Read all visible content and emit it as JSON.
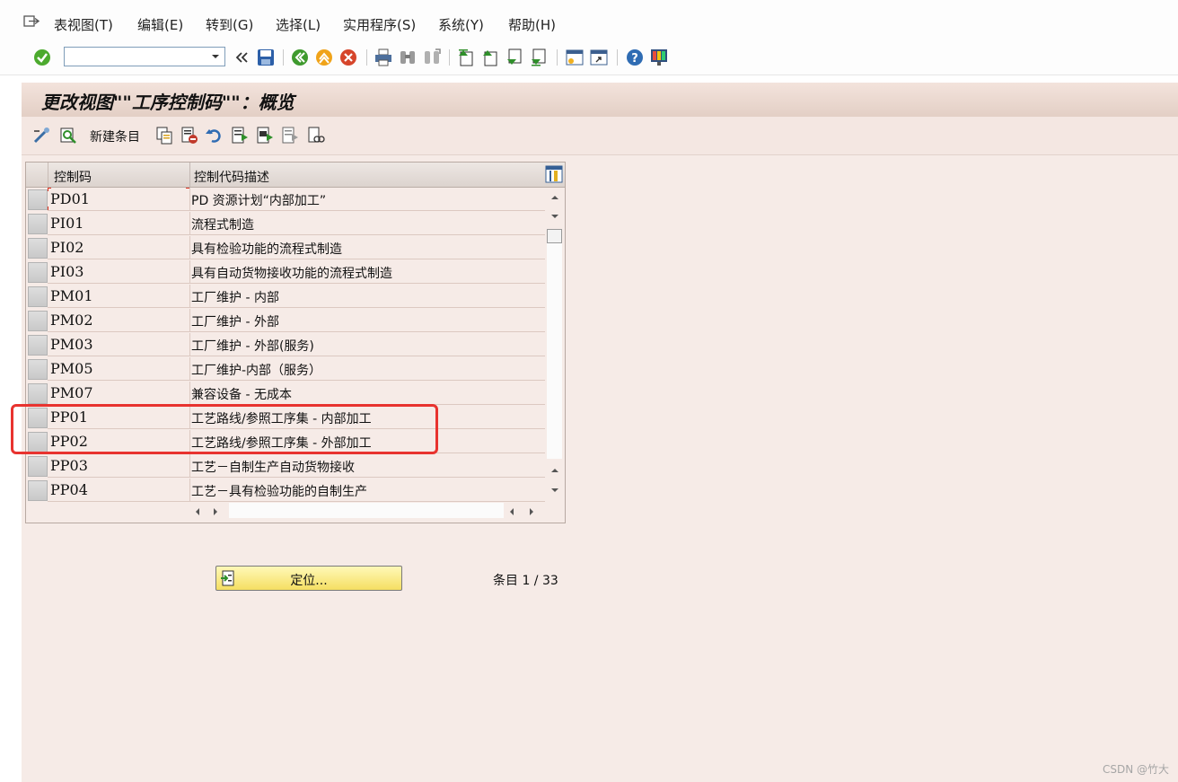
{
  "menubar": {
    "items": [
      "表视图(T)",
      "编辑(E)",
      "转到(G)",
      "选择(L)",
      "实用程序(S)",
      "系统(Y)",
      "帮助(H)"
    ]
  },
  "toolbar": {
    "command_value": ""
  },
  "screen": {
    "title": "更改视图\"\"工序控制码\"\"：概览",
    "new_entries_label": "新建条目"
  },
  "table": {
    "headers": [
      "控制码",
      "控制代码描述"
    ],
    "rows": [
      {
        "code": "PD01",
        "desc": "PD 资源计划“内部加工”"
      },
      {
        "code": "PI01",
        "desc": "流程式制造"
      },
      {
        "code": "PI02",
        "desc": "具有检验功能的流程式制造"
      },
      {
        "code": "PI03",
        "desc": "具有自动货物接收功能的流程式制造"
      },
      {
        "code": "PM01",
        "desc": "工厂维护 - 内部"
      },
      {
        "code": "PM02",
        "desc": "工厂维护 - 外部"
      },
      {
        "code": "PM03",
        "desc": "工厂维护 - 外部(服务)"
      },
      {
        "code": "PM05",
        "desc": "工厂维护-内部（服务）"
      },
      {
        "code": "PM07",
        "desc": "兼容设备 - 无成本"
      },
      {
        "code": "PP01",
        "desc": "工艺路线/参照工序集 - 内部加工"
      },
      {
        "code": "PP02",
        "desc": "工艺路线/参照工序集 - 外部加工"
      },
      {
        "code": "PP03",
        "desc": "工艺－自制生产自动货物接收"
      },
      {
        "code": "PP04",
        "desc": "工艺－具有检验功能的自制生产"
      }
    ]
  },
  "footer": {
    "position_button_label": "定位...",
    "entry_count": "条目 1 / 33"
  },
  "watermark": "CSDN @竹大",
  "colors": {
    "workarea_bg": "#f6ebe7",
    "highlight_border": "#e8332f",
    "position_button": "#f5df62"
  }
}
